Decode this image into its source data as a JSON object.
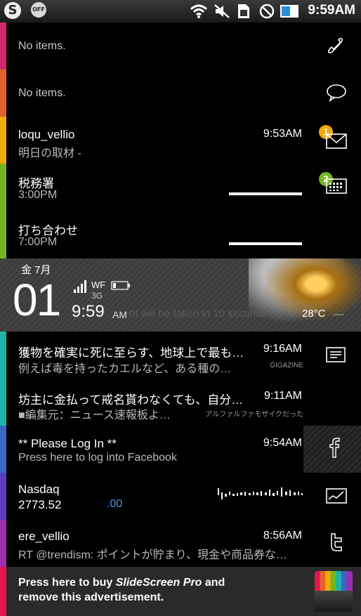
{
  "status_bar": {
    "left_icons": [
      "slidescreen-s-icon",
      "off-bulb-icon"
    ],
    "off_label": "OFF",
    "s_label": "S",
    "right_icons": [
      "wifi-icon",
      "muted-icon",
      "sim-icon",
      "no-signal-icon",
      "battery-icon"
    ],
    "time": "9:59AM"
  },
  "phone": {
    "empty_text": "No items.",
    "icon": "phone-icon",
    "color": "#d1266e"
  },
  "sms": {
    "empty_text": "No items.",
    "icon": "speech-bubble-icon",
    "color": "#e0632a"
  },
  "email": {
    "color": "#f2a900",
    "icon": "envelope-icon",
    "badge": "1",
    "items": [
      {
        "title": "loqu_vellio",
        "subtitle": "明日の取材 -",
        "time": "9:53AM"
      }
    ]
  },
  "calendar": {
    "color": "#76b521",
    "icon": "calendar-icon",
    "badge": "2",
    "items": [
      {
        "title": "税務署",
        "subtitle": "3:00PM"
      },
      {
        "title": "打ち合わせ",
        "subtitle": "7:00PM"
      }
    ]
  },
  "weather": {
    "date": "金 7月",
    "day": "01",
    "network": "WF",
    "network2": "3G",
    "time": "9:59",
    "ampm": "AM",
    "temp": "28°C",
    "temp_extra": "----",
    "overlay_text": "ot will be taken in 10 seconds"
  },
  "news": {
    "color": "#1fb3a4",
    "icon": "news-list-icon",
    "items": [
      {
        "title": "獲物を確実に死に至らす、地球上で最も…",
        "subtitle": "例えば毒を持ったカエルなど、ある種の…",
        "time": "9:16AM",
        "source": "GIGAZINE"
      },
      {
        "title": "坊主に金払って戒名貰わなくても、自分…",
        "subtitle": "■編集元：ニュース速報板よ…",
        "time": "9:11AM",
        "source": "アルファルファモザイクだった"
      }
    ]
  },
  "facebook": {
    "color": "#3b66c4",
    "icon": "facebook-icon",
    "title": "** Please Log In **",
    "subtitle": "Press here to log into Facebook",
    "time": "9:54AM"
  },
  "stocks": {
    "color": "#5b3fbf",
    "icon": "chart-icon",
    "name": "Nasdaq",
    "value": "2773.52",
    "change": ".00",
    "change_color": "#4a9be8"
  },
  "twitter": {
    "color": "#9b2fb0",
    "icon": "twitter-icon",
    "title": "ere_vellio",
    "subtitle": "RT @trendism: ポイントが貯まり、現金や商品券な…",
    "time": "8:56AM"
  },
  "ad": {
    "color": "#e4154f",
    "line1_pre": "Press here to buy ",
    "line1_em": "SlideScreen Pro",
    "line1_post": " and",
    "line2": "remove this advertisement.",
    "icon": "slidescreen-pro-icon"
  }
}
